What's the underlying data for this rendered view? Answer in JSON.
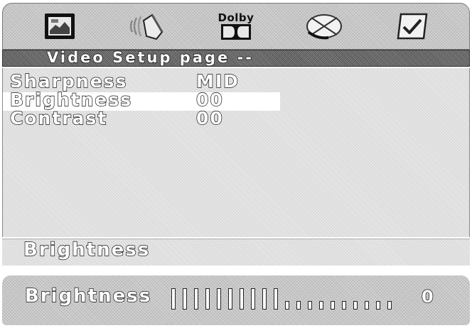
{
  "menu": {
    "tabs": [
      {
        "name": "general-setup",
        "icon": "tv-screen-icon"
      },
      {
        "name": "audio-setup",
        "icon": "speaker-icon"
      },
      {
        "name": "dolby-setup",
        "icon": "dolby-icon",
        "label": "Dolby"
      },
      {
        "name": "video-setup",
        "icon": "disc-icon"
      },
      {
        "name": "preference-setup",
        "icon": "checklist-icon"
      }
    ]
  },
  "header": {
    "title": "Video Setup page --"
  },
  "settings": [
    {
      "label": "Sharpness",
      "value": "MID",
      "selected": false
    },
    {
      "label": "Brightness",
      "value": "00",
      "selected": true
    },
    {
      "label": "Contrast",
      "value": "00",
      "selected": false
    }
  ],
  "description": {
    "text": "Brightness"
  },
  "level": {
    "label": "Brightness",
    "value": "0",
    "ticks_total": 20,
    "ticks_filled": 10,
    "fraction": 0.5
  },
  "colors": {
    "panel_grey": "#c9c9c9",
    "header_dark": "#7a7a7a",
    "selection": "#ffffff",
    "text_outline": "#111111"
  }
}
